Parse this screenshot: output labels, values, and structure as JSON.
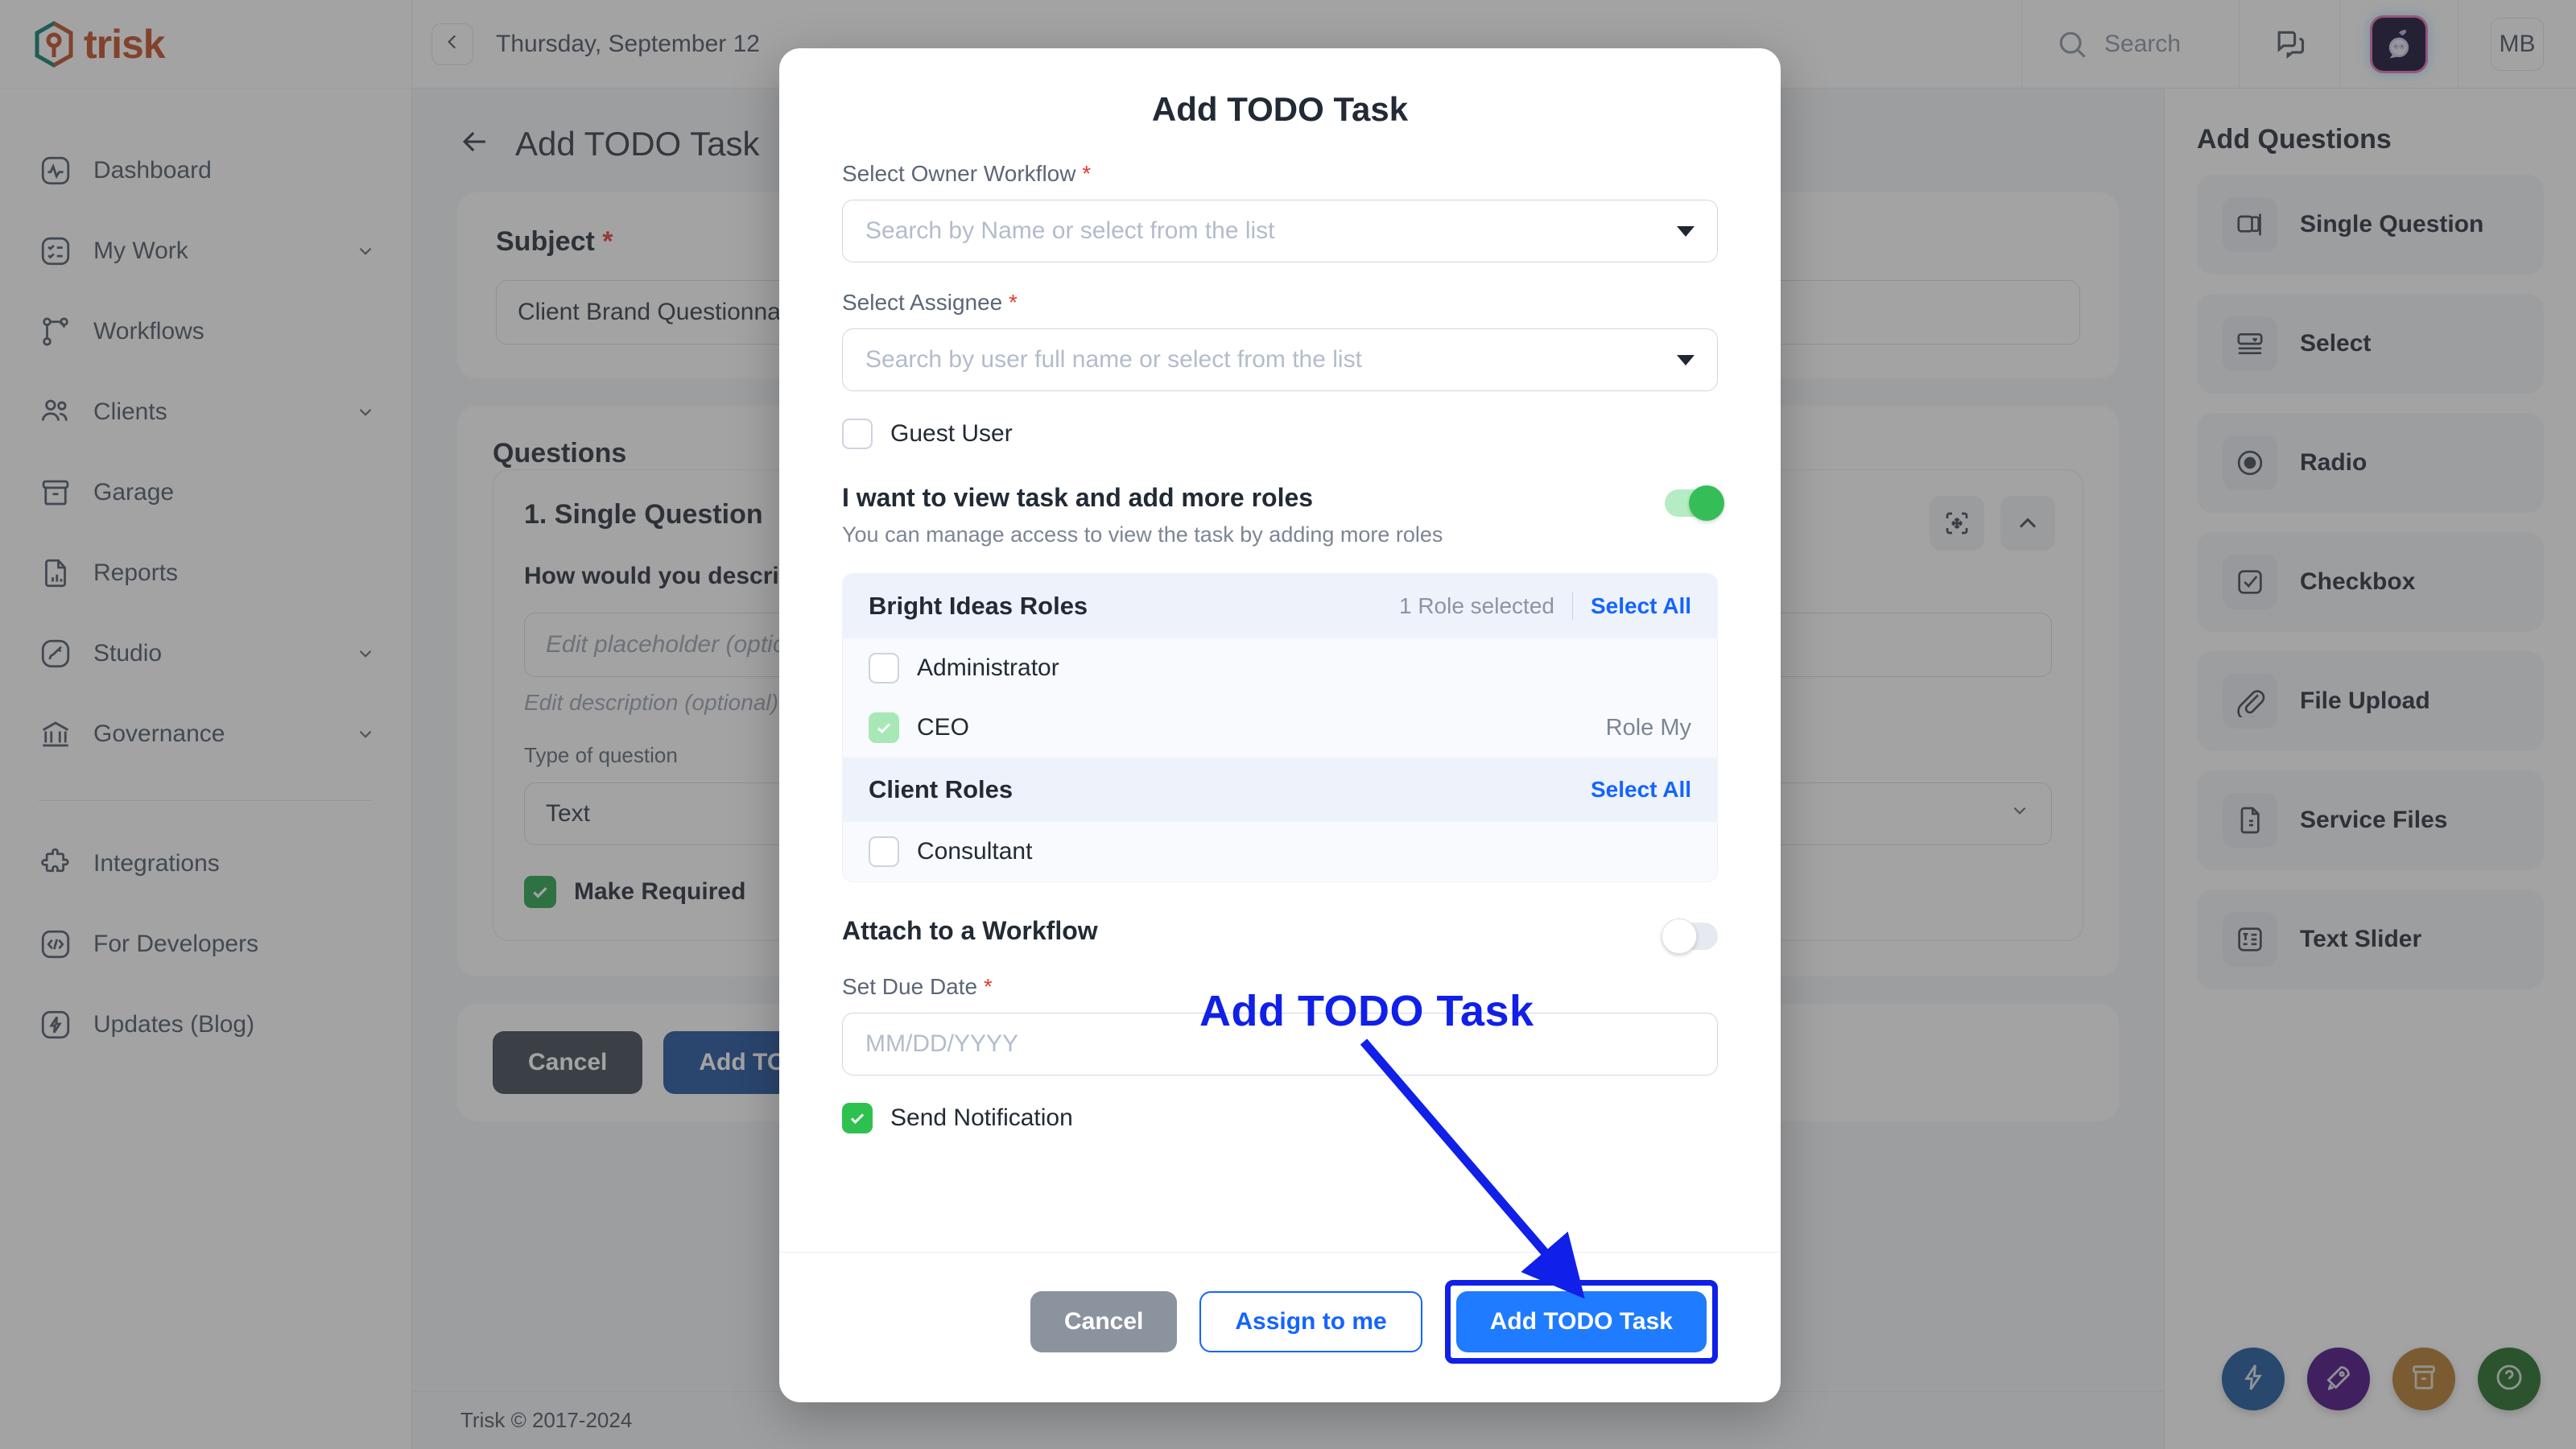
{
  "brand": {
    "name": "trisk"
  },
  "topbar": {
    "collapse_icon": "chevron-left-icon",
    "date": "Thursday, September 12",
    "search_placeholder": "Search",
    "search_icon": "search-icon",
    "chat_icon": "chat-bubbles-icon",
    "bot_icon": "ai-bot-icon",
    "avatar_initials": "MB"
  },
  "sidebar": {
    "items": [
      {
        "label": "Dashboard",
        "icon": "activity-icon",
        "chevron": false
      },
      {
        "label": "My Work",
        "icon": "checklist-icon",
        "chevron": true
      },
      {
        "label": "Workflows",
        "icon": "workflow-icon",
        "chevron": false
      },
      {
        "label": "Clients",
        "icon": "users-icon",
        "chevron": true
      },
      {
        "label": "Garage",
        "icon": "archive-icon",
        "chevron": false
      },
      {
        "label": "Reports",
        "icon": "report-icon",
        "chevron": false
      },
      {
        "label": "Studio",
        "icon": "brush-icon",
        "chevron": true
      },
      {
        "label": "Governance",
        "icon": "bank-icon",
        "chevron": true
      }
    ],
    "items_secondary": [
      {
        "label": "Integrations",
        "icon": "puzzle-icon",
        "chevron": false
      },
      {
        "label": "For Developers",
        "icon": "code-icon",
        "chevron": false
      },
      {
        "label": "Updates (Blog)",
        "icon": "bolt-icon",
        "chevron": false
      }
    ]
  },
  "main": {
    "page_title": "Add TODO Task",
    "back_icon": "arrow-left-icon",
    "subject": {
      "label": "Subject",
      "required_mark": "*",
      "value": "Client Brand Questionnaire"
    },
    "questions": {
      "heading": "Questions",
      "item_number": "1. Single Question",
      "question_text": "How would you describe your brand",
      "placeholder_input": "Edit placeholder (optional)",
      "description_placeholder": "Edit description (optional)",
      "type_label": "Type of question",
      "type_value": "Text",
      "make_required_label": "Make Required",
      "tool_move_icon": "move-icon",
      "tool_collapse_icon": "chevron-up-icon"
    },
    "footer": {
      "cancel": "Cancel",
      "submit": "Add TODO Task"
    },
    "copyright": "Trisk © 2017-2024"
  },
  "right_panel": {
    "title": "Add Questions",
    "items": [
      {
        "label": "Single Question",
        "icon": "single-question-icon"
      },
      {
        "label": "Select",
        "icon": "select-dropdown-icon"
      },
      {
        "label": "Radio",
        "icon": "radio-icon"
      },
      {
        "label": "Checkbox",
        "icon": "checkbox-icon"
      },
      {
        "label": "File Upload",
        "icon": "paperclip-icon"
      },
      {
        "label": "Service Files",
        "icon": "service-file-icon"
      },
      {
        "label": "Text Slider",
        "icon": "text-slider-icon"
      }
    ]
  },
  "fabs": [
    {
      "name": "quick-action-bolt",
      "icon": "bolt-icon",
      "color": "#17539b"
    },
    {
      "name": "quick-action-launch",
      "icon": "rocket-icon",
      "color": "#46097f"
    },
    {
      "name": "quick-action-box",
      "icon": "archive-icon",
      "color": "#b4792b"
    },
    {
      "name": "quick-action-help",
      "icon": "help-icon",
      "color": "#1d6b23"
    }
  ],
  "modal": {
    "title": "Add TODO Task",
    "owner_workflow": {
      "label": "Select Owner Workflow",
      "required_mark": "*",
      "placeholder": "Search by Name or select from the list",
      "value": ""
    },
    "assignee": {
      "label": "Select Assignee",
      "required_mark": "*",
      "placeholder": "Search by user full name or select from the list",
      "value": ""
    },
    "guest_user": {
      "label": "Guest User",
      "checked": false
    },
    "view_task_toggle": {
      "title": "I want to view task and add more roles",
      "subtitle": "You can manage access to view the task by adding more roles",
      "on": true
    },
    "role_groups": [
      {
        "title": "Bright Ideas Roles",
        "count_text": "1 Role selected",
        "select_all": "Select All",
        "roles": [
          {
            "name": "Administrator",
            "checked": false,
            "meta": ""
          },
          {
            "name": "CEO",
            "checked": true,
            "meta": "Role My"
          }
        ]
      },
      {
        "title": "Client Roles",
        "count_text": "",
        "select_all": "Select All",
        "roles": [
          {
            "name": "Consultant",
            "checked": false,
            "meta": ""
          }
        ]
      }
    ],
    "attach_workflow": {
      "title": "Attach to a Workflow",
      "on": false
    },
    "due_date": {
      "label": "Set Due Date",
      "required_mark": "*",
      "placeholder": "MM/DD/YYYY",
      "value": ""
    },
    "send_notification": {
      "label": "Send Notification",
      "checked": true
    },
    "footer": {
      "cancel": "Cancel",
      "assign_to_me": "Assign to me",
      "submit": "Add TODO Task"
    }
  },
  "annotation": {
    "text": "Add TODO Task",
    "color": "#1020e8"
  }
}
